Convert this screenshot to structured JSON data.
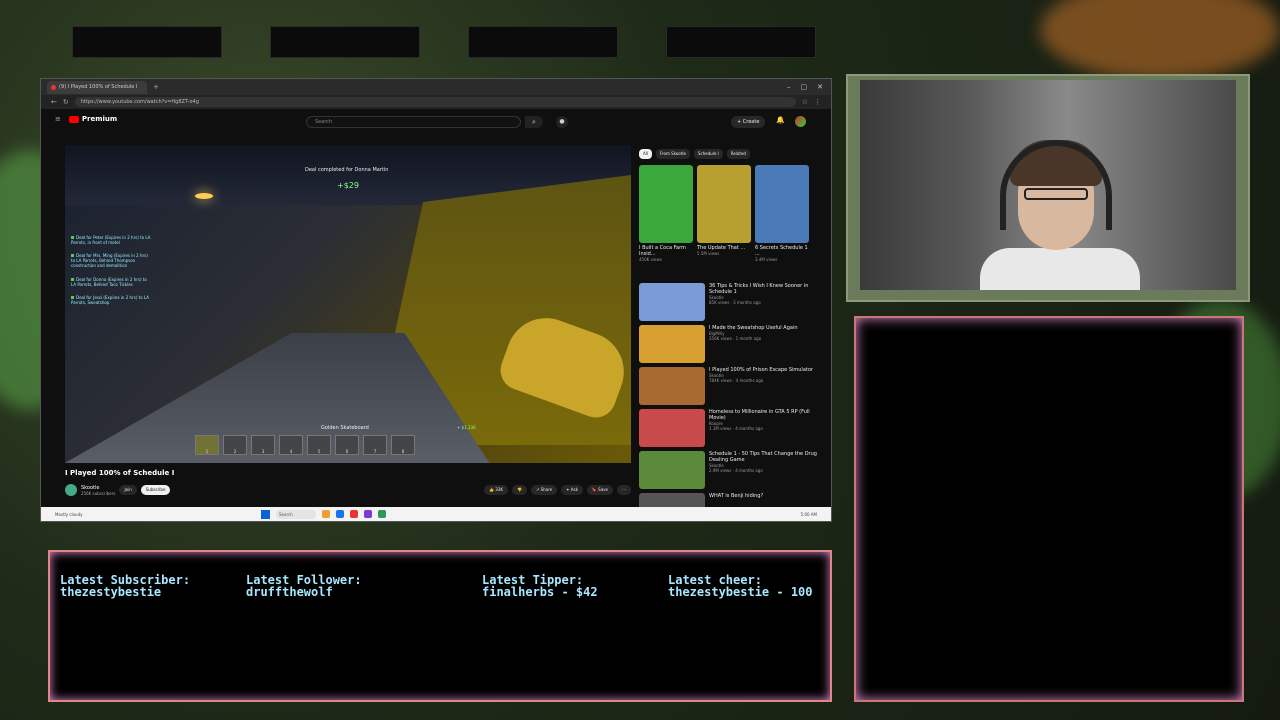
{
  "browser": {
    "tab_title": "(9) I Played 100% of Schedule I",
    "url": "https://www.youtube.com/watch?v=Hg8ZT-o4g",
    "window_controls": [
      "–",
      "▢",
      "✕"
    ]
  },
  "youtube": {
    "logo_text": "Premium",
    "search_placeholder": "Search",
    "create_label": "Create"
  },
  "game": {
    "deal_text": "Deal completed for Donna Martin",
    "money_popup": "+$29",
    "quests": [
      "Deal for Peter (Expires in 2 hrs) to LA Parrots, in front of motel",
      "Deal for Mrs. Ming (Expires in 2 hrs) to LA Parrots, Behind Thompson construction and demolition",
      "Deal for Donna (Expires in 2 hrs) to LA Parrots, Behind Taco Tickles",
      "Deal for Jessi (Expires in 2 hrs) to LA Parrots, Sweatshop"
    ],
    "selected_item": "Golden Skateboard",
    "cash": "+ $1,336",
    "hotbar_slots": [
      "1",
      "2",
      "3",
      "4",
      "5",
      "6",
      "7",
      "8"
    ]
  },
  "video": {
    "title": "I Played 100% of Schedule I",
    "channel": "Skootle",
    "subscribers": "256K subscribers",
    "join_label": "Join",
    "subscribe_label": "Subscribe",
    "likes": "33K",
    "share_label": "Share",
    "ask_label": "Ask",
    "save_label": "Save"
  },
  "sidebar": {
    "chips": [
      "All",
      "From Skootle",
      "Schedule I",
      "Related"
    ],
    "shelf": [
      {
        "title": "I Built a Coca Farm Insid...",
        "meta": "450K views",
        "color": "#3aa83a"
      },
      {
        "title": "The Update That ...",
        "meta": "5.5M views",
        "color": "#b8a030"
      },
      {
        "title": "6 Secrets Schedule 1 ...",
        "meta": "3.4M views",
        "color": "#4a7ab8"
      }
    ],
    "recs": [
      {
        "title": "36 Tips & Tricks I Wish I Knew Sooner in Schedule 1",
        "channel": "Skootle",
        "meta": "85K views · 3 months ago",
        "color": "#7a9ad8"
      },
      {
        "title": "I Made the Sweatshop Useful Again",
        "channel": "BigMilly",
        "meta": "256K views · 1 month ago",
        "color": "#d8a030"
      },
      {
        "title": "I Played 100% of Prison Escape Simulator",
        "channel": "Skootle",
        "meta": "784K views · 4 months ago",
        "color": "#a86a30"
      },
      {
        "title": "Homeless to Millionaire in GTA 5 RP (Full Movie)",
        "channel": "Koopre",
        "meta": "1.1M views · 4 months ago",
        "color": "#c84a4a"
      },
      {
        "title": "Schedule 1 - 50 Tips That Change the Drug Dealing Game",
        "channel": "Skootle",
        "meta": "2.9M views · 4 months ago",
        "color": "#5a8a3a"
      },
      {
        "title": "WHAT is Benji hiding?",
        "channel": "",
        "meta": "",
        "color": "#555"
      }
    ]
  },
  "taskbar": {
    "weather": "Mostly cloudy",
    "search_label": "Search",
    "clock": "5:00 AM"
  },
  "ticker": {
    "subscriber_label": "Latest Subscriber:",
    "subscriber_name": "thezestybestie",
    "follower_label": "Latest Follower:",
    "follower_name": "druffthewolf",
    "tipper_label": "Latest Tipper:",
    "tipper_value": "finalherbs - $42",
    "cheer_label": "Latest cheer:",
    "cheer_value": "thezestybestie - 100"
  }
}
